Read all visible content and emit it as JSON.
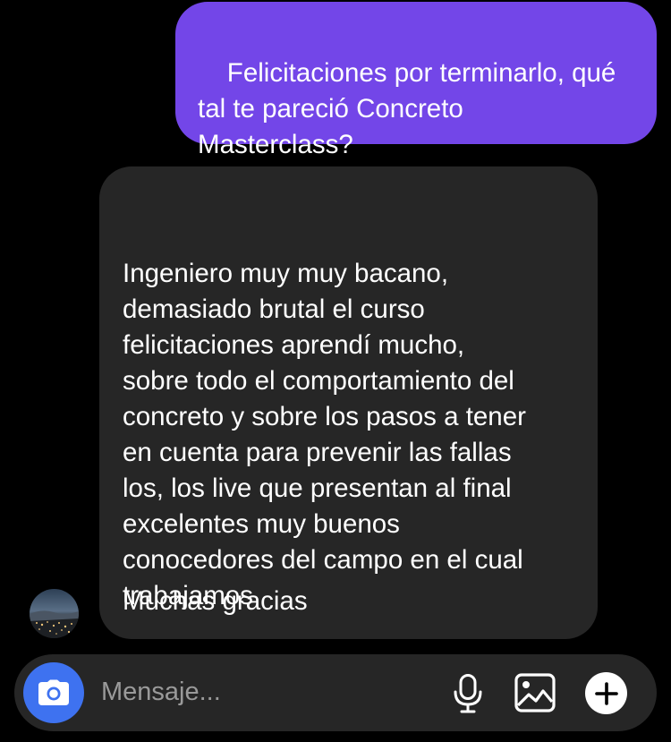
{
  "thread": {
    "sent_message": {
      "text": "Felicitaciones por terminarlo, qué\ntal te pareció Concreto\nMasterclass?"
    },
    "received_message": {
      "body": "Ingeniero muy muy bacano,\ndemasiado brutal el curso\nfelicitaciones aprendí mucho,\nsobre todo el comportamiento del\nconcreto y sobre los pasos a tener\nen cuenta para prevenir las fallas\nlos, los live que presentan al final\nexcelentes muy buenos\nconocedores del campo en el cual\ntrabajamos",
      "closing": "Muchas gracias"
    },
    "avatar": {
      "icon": "contact-avatar"
    }
  },
  "composer": {
    "placeholder": "Mensaje...",
    "value": "",
    "camera_icon": "camera-icon",
    "mic_icon": "microphone-icon",
    "gallery_icon": "image-icon",
    "plus_icon": "plus-icon"
  },
  "colors": {
    "background": "#000000",
    "sent_bubble": "#7346e8",
    "received_bubble": "#262626",
    "composer_bg": "#262626",
    "camera_button": "#3e72f0",
    "placeholder": "#9a9a9a"
  }
}
